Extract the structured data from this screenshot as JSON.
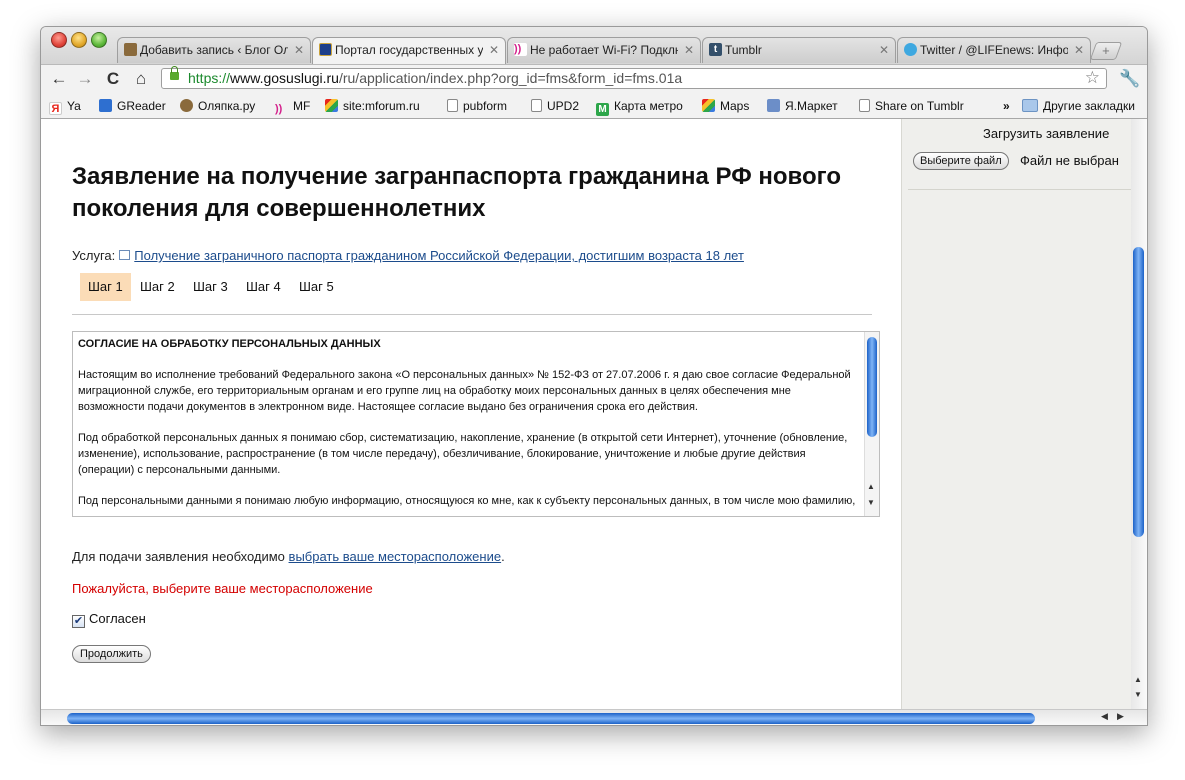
{
  "tabs": [
    {
      "title": "Добавить запись ‹ Блог Оля",
      "favicon": "wordpress-icon",
      "active": false
    },
    {
      "title": "Портал государственных у",
      "favicon": "emblem-icon",
      "active": true
    },
    {
      "title": "Не работает Wi-Fi? Подклю",
      "favicon": "mf-icon",
      "active": false
    },
    {
      "title": "Tumblr",
      "favicon": "tumblr-icon",
      "active": false
    },
    {
      "title": "Twitter / @LIFEnews: Инфор",
      "favicon": "twitter-icon",
      "active": false
    }
  ],
  "toolbar": {
    "back": "←",
    "forward": "→",
    "reload": "C",
    "home": "⌂",
    "wrench": "🔧",
    "star": "☆"
  },
  "url": {
    "scheme": "https://",
    "host": "www.gosuslugi.ru",
    "path": "/ru/application/index.php?org_id=fms&form_id=fms.01a"
  },
  "bookmarks": [
    {
      "label": "Ya",
      "icon": "yandex-icon",
      "color": "#e8261c"
    },
    {
      "label": "GReader",
      "icon": "greader-icon",
      "color": "#2e6fd0"
    },
    {
      "label": "Оляпка.ру",
      "icon": "user-icon",
      "color": "#8a6a3c"
    },
    {
      "label": "MF",
      "icon": "mf-icon",
      "color": "#d4218c"
    },
    {
      "label": "site:mforum.ru",
      "icon": "google-icon",
      "color": "#3a7be0"
    },
    {
      "label": "pubform",
      "icon": "page-icon",
      "color": "#ffffff"
    },
    {
      "label": "UPD2",
      "icon": "page-icon",
      "color": "#ffffff"
    },
    {
      "label": "Карта метро",
      "icon": "metro-icon",
      "color": "#2da64a"
    },
    {
      "label": "Maps",
      "icon": "google-icon",
      "color": "#3a7be0"
    },
    {
      "label": "Я.Маркет",
      "icon": "market-icon",
      "color": "#6c8ec8"
    },
    {
      "label": "Share on Tumblr",
      "icon": "page-icon",
      "color": "#ffffff"
    }
  ],
  "bookmarks_more": "»",
  "other_bookmarks": "Другие закладки",
  "page": {
    "title": "Заявление на получение загранпаспорта гражданина РФ нового поколения для совершеннолетних",
    "service_label": "Услуга:",
    "service_link": "Получение заграничного паспорта гражданином Российской Федерации, достигшим возраста 18 лет",
    "steps": [
      "Шаг 1",
      "Шаг 2",
      "Шаг 3",
      "Шаг 4",
      "Шаг 5"
    ],
    "active_step": "Шаг 1",
    "agreement": {
      "heading": "СОГЛАСИЕ НА ОБРАБОТКУ ПЕРСОНАЛЬНЫХ ДАННЫХ",
      "paragraphs": [
        "Настоящим во исполнение требований Федерального закона «О персональных данных» № 152-ФЗ от 27.07.2006 г. я даю свое согласие Федеральной миграционной службе, его территориальным органам и его группе лиц на обработку моих персональных данных в целях обеспечения мне возможности подачи документов в электронном виде. Настоящее согласие выдано без ограничения срока его действия.",
        "Под обработкой персональных данных я понимаю сбор, систематизацию, накопление, хранение (в открытой сети Интернет), уточнение (обновление, изменение), использование, распространение (в том числе передачу), обезличивание, блокирование, уничтожение и любые другие действия (операции) с персональными данными.",
        "Под персональными данными я понимаю любую информацию, относящуюся ко мне, как к субъекту персональных данных, в том числе мою фамилию,"
      ]
    },
    "notice_text": "Для подачи заявления необходимо",
    "notice_link": "выбрать ваше месторасположение",
    "notice_end": ".",
    "error": "Пожалуйста, выберите ваше месторасположение",
    "agree_checkbox": {
      "label": "Согласен",
      "checked": true
    },
    "continue_button": "Продолжить"
  },
  "sidebar": {
    "upload_title": "Загрузить заявление",
    "file_button": "Выберите файл",
    "file_status": "Файл не выбран"
  },
  "colors": {
    "active_step_bg": "#fbdcb7",
    "error": "#d40000",
    "link": "#1c4c8c",
    "scroll_thumb": "#3a7be0"
  }
}
